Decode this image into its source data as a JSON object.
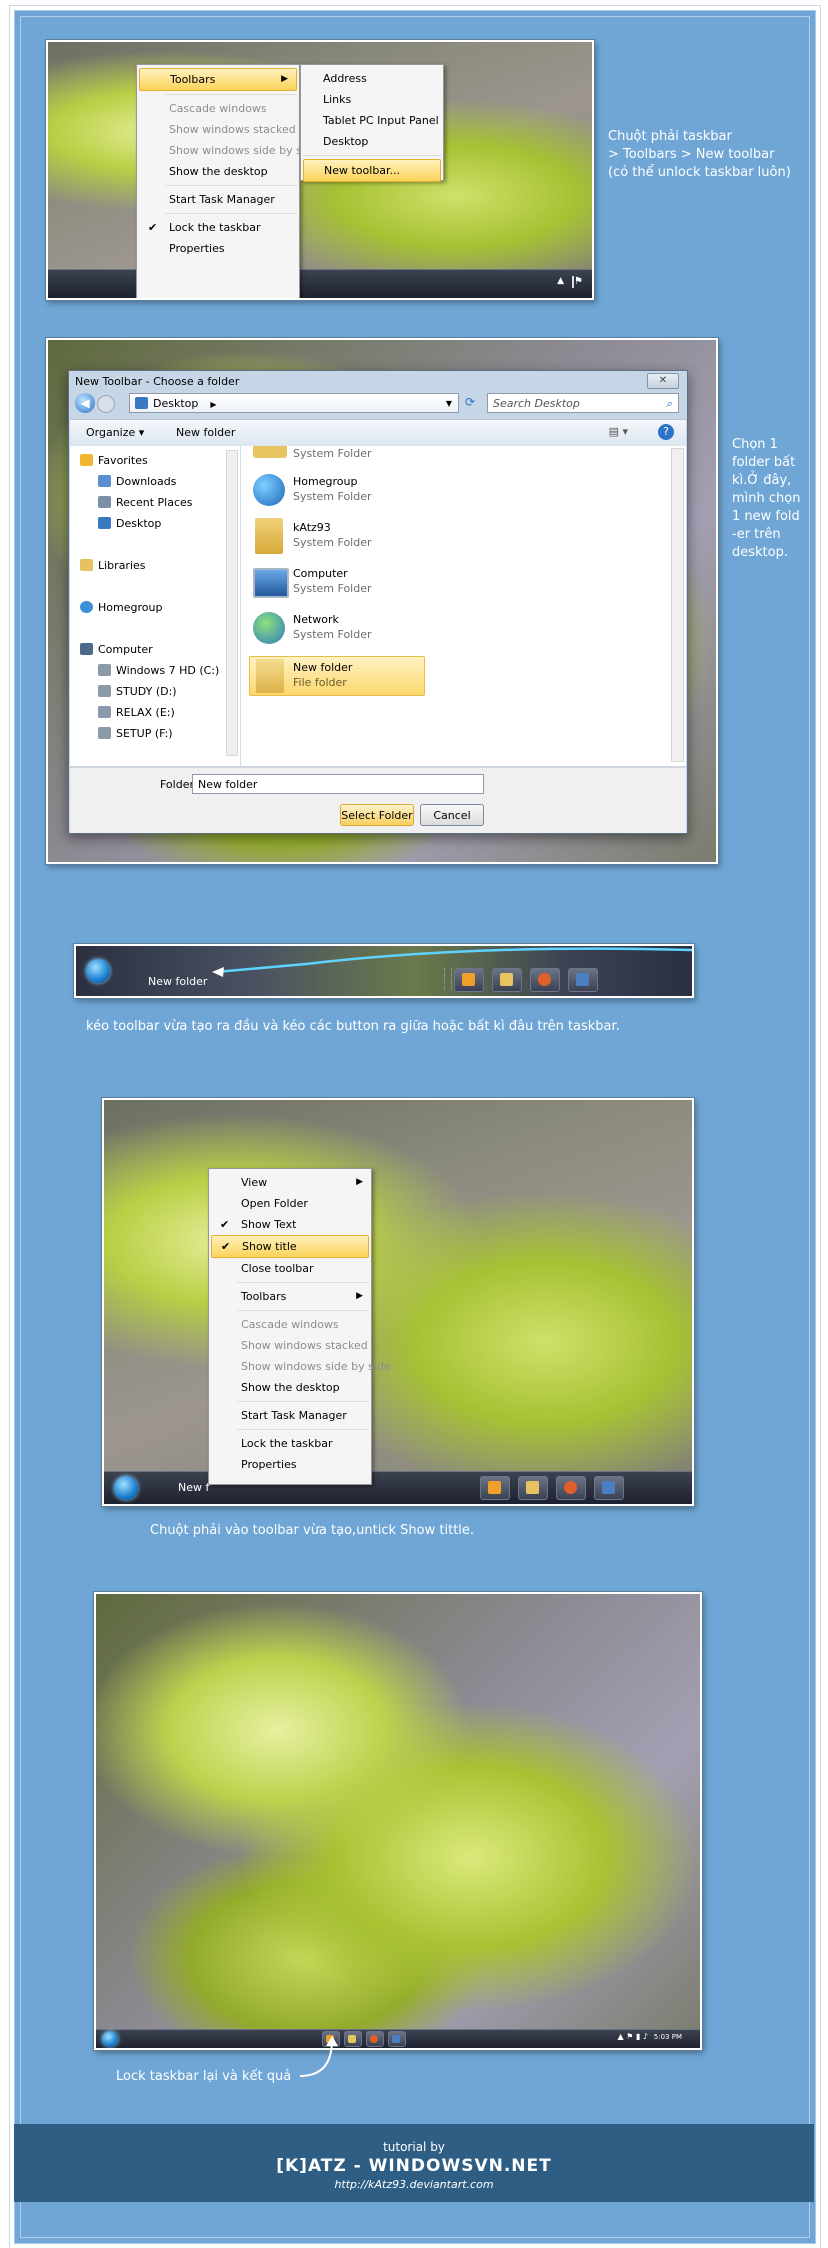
{
  "step1": {
    "menu": {
      "items": [
        {
          "label": "Toolbars",
          "state": "highlighted",
          "submenu": true
        },
        {
          "label": "Cascade windows",
          "state": "disabled"
        },
        {
          "label": "Show windows stacked",
          "state": "disabled"
        },
        {
          "label": "Show windows side by side",
          "state": "disabled"
        },
        {
          "label": "Show the desktop",
          "state": "normal"
        },
        {
          "label": "Start Task Manager",
          "state": "normal"
        },
        {
          "label": "Lock the taskbar",
          "state": "checked"
        },
        {
          "label": "Properties",
          "state": "normal"
        }
      ],
      "submenu": [
        "Address",
        "Links",
        "Tablet PC Input Panel",
        "Desktop",
        "New toolbar..."
      ]
    },
    "caption_lines": [
      "Chuột phải taskbar",
      "> Toolbars > New toolbar",
      "(có thể unlock taskbar luôn)"
    ]
  },
  "step2": {
    "dialog_title": "New Toolbar - Choose a folder",
    "address": "Desktop",
    "search_placeholder": "Search Desktop",
    "organize_label": "Organize",
    "new_folder_label": "New folder",
    "nav": {
      "favorites": "Favorites",
      "downloads": "Downloads",
      "recent": "Recent Places",
      "desktop": "Desktop",
      "libraries": "Libraries",
      "homegroup": "Homegroup",
      "computer": "Computer",
      "drive_c": "Windows 7 HD (C:)",
      "drive_d": "STUDY (D:)",
      "drive_e": "RELAX (E:)",
      "drive_f": "SETUP (F:)"
    },
    "items": [
      {
        "name": "",
        "sub": "System Folder"
      },
      {
        "name": "Homegroup",
        "sub": "System Folder"
      },
      {
        "name": "kAtz93",
        "sub": "System Folder"
      },
      {
        "name": "Computer",
        "sub": "System Folder"
      },
      {
        "name": "Network",
        "sub": "System Folder"
      },
      {
        "name": "New folder",
        "sub": "File folder"
      }
    ],
    "folder_label": "Folder:",
    "folder_value": "New folder",
    "select_button": "Select Folder",
    "cancel_button": "Cancel",
    "caption_lines": [
      "Chọn 1",
      "folder bất",
      "kì.Ở đây,",
      "mình chọn",
      "1 new fold",
      "-er trên",
      "desktop."
    ]
  },
  "step3": {
    "toolbar_label": "New folder",
    "caption": "kéo toolbar vừa tạo ra đầu và kéo các button ra giữa hoặc bất kì đâu trên taskbar."
  },
  "step4": {
    "menu": {
      "items": [
        {
          "label": "View",
          "state": "normal",
          "submenu": true
        },
        {
          "label": "Open Folder",
          "state": "normal"
        },
        {
          "label": "Show Text",
          "state": "checked"
        },
        {
          "label": "Show title",
          "state": "checked-highlighted"
        },
        {
          "label": "Close toolbar",
          "state": "normal"
        },
        {
          "label": "Toolbars",
          "state": "normal",
          "submenu": true
        },
        {
          "label": "Cascade windows",
          "state": "disabled"
        },
        {
          "label": "Show windows stacked",
          "state": "disabled"
        },
        {
          "label": "Show windows side by side",
          "state": "disabled"
        },
        {
          "label": "Show the desktop",
          "state": "normal"
        },
        {
          "label": "Start Task Manager",
          "state": "normal"
        },
        {
          "label": "Lock the taskbar",
          "state": "normal"
        },
        {
          "label": "Properties",
          "state": "normal"
        }
      ]
    },
    "taskbar_text": "New f",
    "caption": "Chuột phải vào toolbar vừa tạo,untick Show tittle."
  },
  "step5": {
    "clock": "5:03 PM",
    "caption": "Lock taskbar lại và kết quả"
  },
  "footer": {
    "line1": "tutorial by",
    "line2": "[K]ATZ - WINDOWSVN.NET",
    "line3": "http://kAtz93.deviantart.com"
  },
  "colors": {
    "background": "#6fa6d5",
    "highlight": "#fcd35a",
    "footer": "#2f5e85"
  }
}
